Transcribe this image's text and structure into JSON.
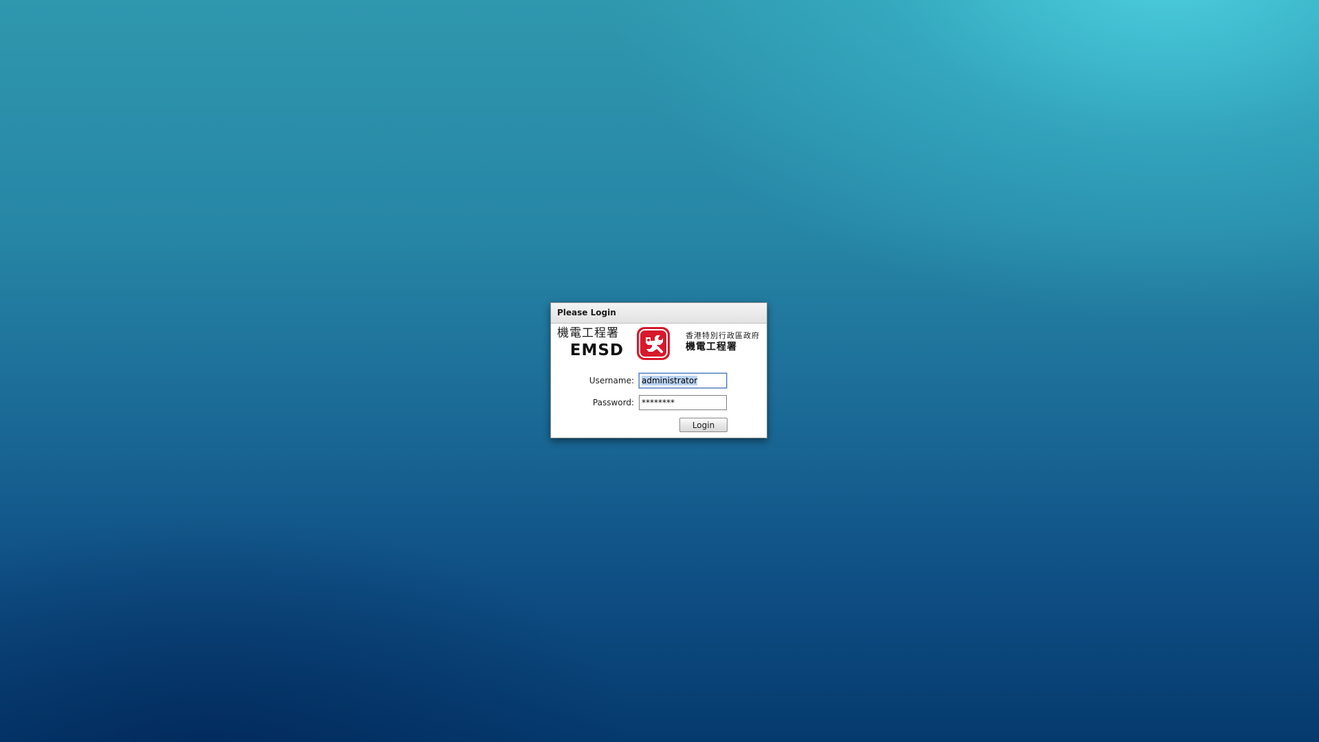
{
  "dialog": {
    "title": "Please Login"
  },
  "logo": {
    "chinese_name": "機電工程署",
    "abbreviation": "EMSD",
    "government": "香港特別行政區政府",
    "department": "機電工程署",
    "emblem_color": "#d7192b"
  },
  "form": {
    "username_label": "Username:",
    "username_value": "administrator",
    "password_label": "Password:",
    "password_value": "********",
    "login_label": "Login"
  },
  "colors": {
    "background_top_right": "#4fd0dd",
    "background_bottom": "#053a6e",
    "dialog_background": "#ffffff",
    "focus_border": "#5a7fb8"
  }
}
